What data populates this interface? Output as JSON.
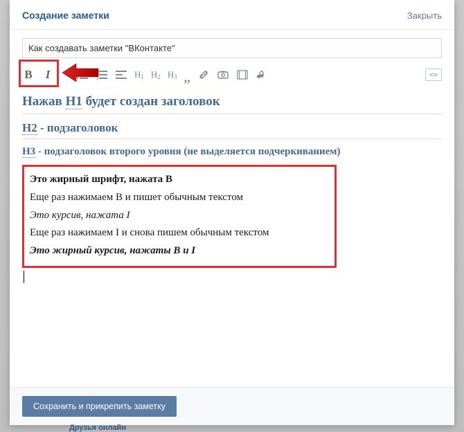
{
  "header": {
    "title": "Создание заметки",
    "close": "Закрыть"
  },
  "title_input": {
    "value": "Как создавать заметки \"ВКонтакте\""
  },
  "toolbar": {
    "buttons": [
      "bold",
      "italic",
      "list-bulleted",
      "list-numbered",
      "align",
      "h1",
      "h2",
      "h3",
      "quote",
      "link",
      "photo",
      "video",
      "audio",
      "source-code"
    ]
  },
  "content": {
    "h1": {
      "pre": "Нажав ",
      "ul": "H1",
      "post": " будет создан заголовок"
    },
    "h2": {
      "ul": "H2",
      "post": " - подзаголовок"
    },
    "h3": {
      "ul": "H3",
      "post": " - подзаголовок второго уровня (не выделяется подчеркиванием)"
    },
    "samples": [
      "Это жирный шрифт, нажата B",
      "Еще раз нажимаем B и пишет обычным текстом",
      "Это курсив, нажата I",
      "Еще раз нажимаем I и снова пишем обычным текстом",
      "Это жирный курсив, нажаты B и I"
    ]
  },
  "footer": {
    "save": "Сохранить и прикрепить заметку"
  },
  "background": {
    "friends_online": "Друзья онлайн"
  },
  "annotations": {
    "highlights": [
      "bold-italic-group",
      "text-style-samples"
    ],
    "arrow_points_to": "bold-italic-group"
  },
  "colors": {
    "link": "#2a5885",
    "heading": "#45688e",
    "button": "#5b7ca3",
    "highlight": "#e03030",
    "icon": "#828a99"
  }
}
